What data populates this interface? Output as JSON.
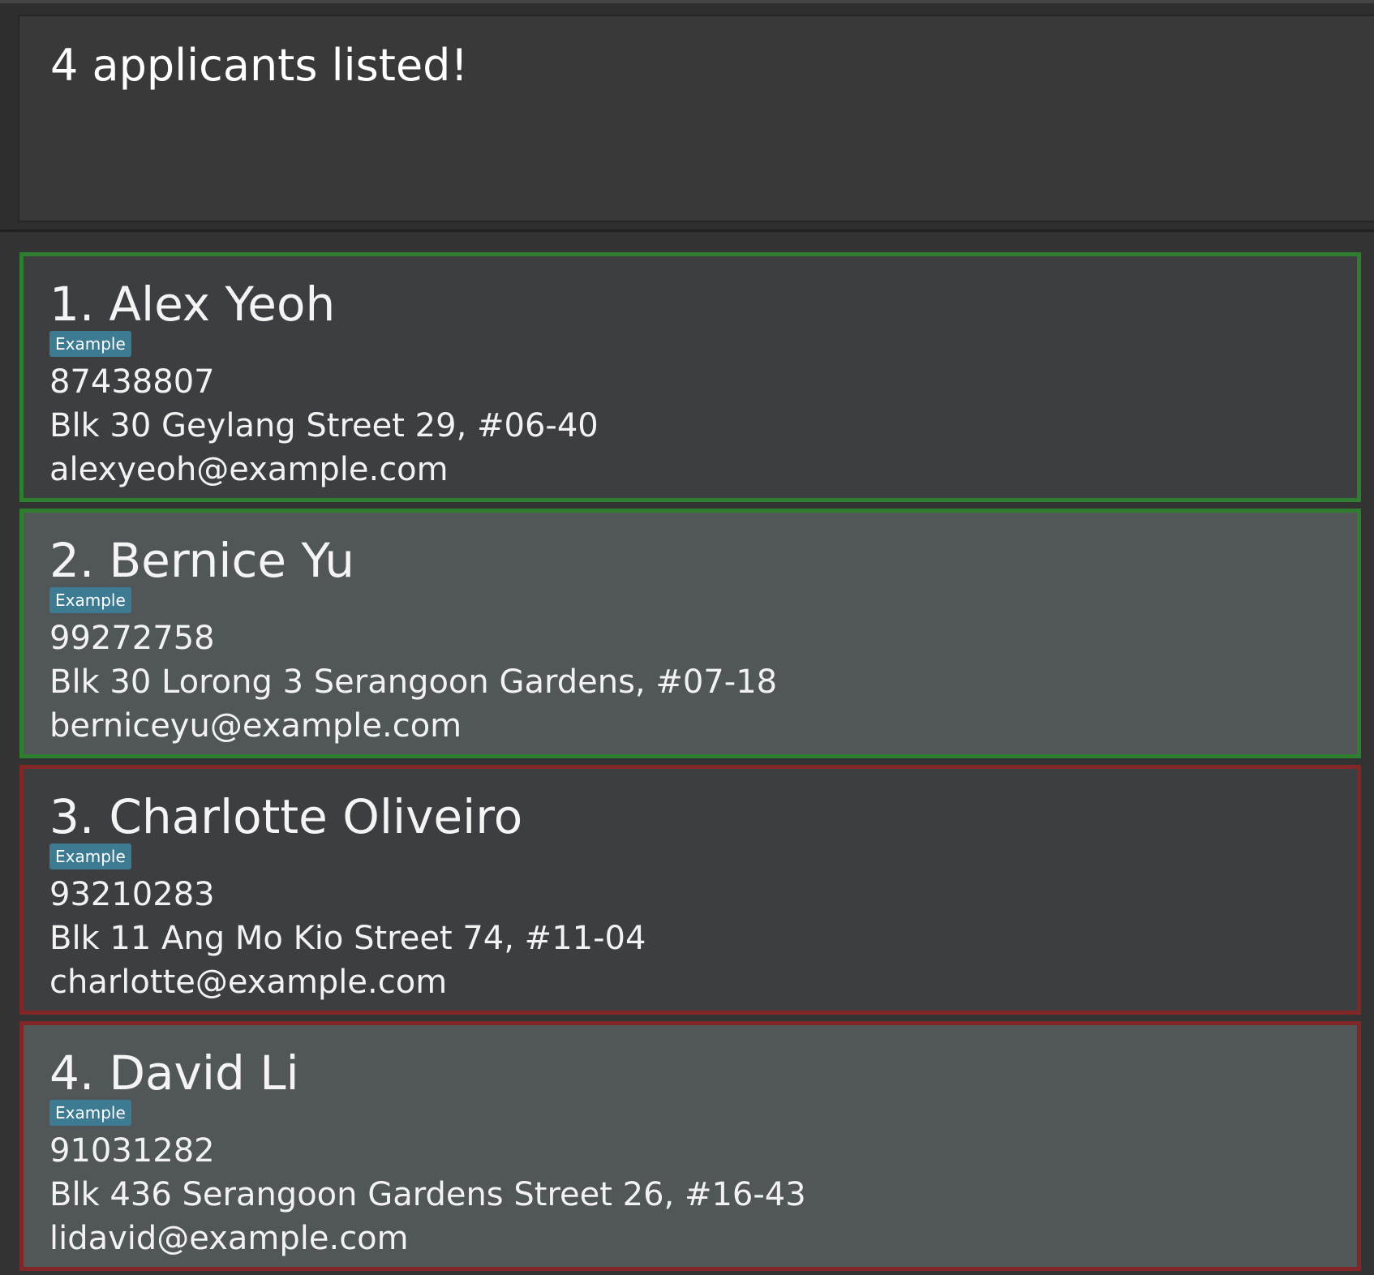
{
  "result_display": {
    "message": "4 applicants listed!"
  },
  "applicants": [
    {
      "index": "1.",
      "name": "Alex Yeoh",
      "tag": "Example",
      "phone": "87438807",
      "address": "Blk 30 Geylang Street 29, #06-40",
      "email": "alexyeoh@example.com",
      "border_color": "#2f7d2f"
    },
    {
      "index": "2.",
      "name": "Bernice Yu",
      "tag": "Example",
      "phone": "99272758",
      "address": "Blk 30 Lorong 3 Serangoon Gardens, #07-18",
      "email": "berniceyu@example.com",
      "border_color": "#2f7d2f"
    },
    {
      "index": "3.",
      "name": "Charlotte Oliveiro",
      "tag": "Example",
      "phone": "93210283",
      "address": "Blk 11 Ang Mo Kio Street 74, #11-04",
      "email": "charlotte@example.com",
      "border_color": "#812727"
    },
    {
      "index": "4.",
      "name": "David Li",
      "tag": "Example",
      "phone": "91031282",
      "address": "Blk 436 Serangoon Gardens Street 26, #16-43",
      "email": "lidavid@example.com",
      "border_color": "#812727"
    }
  ],
  "colors": {
    "tag_background": "#3d7b93",
    "card_odd_background": "#3c3e41",
    "card_even_background": "#515659"
  }
}
